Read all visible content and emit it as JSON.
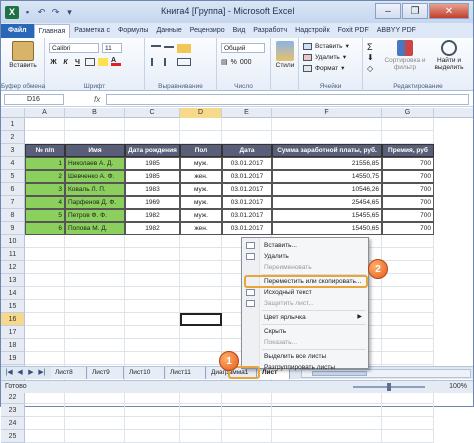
{
  "window": {
    "title": "Книга4 [Группа] - Microsoft Excel",
    "qat_icons": [
      "excel-logo-icon",
      "save-icon",
      "undo-icon",
      "redo-icon",
      "customize-icon"
    ],
    "logo_letter": "X",
    "min": "–",
    "max": "❐",
    "close": "✕"
  },
  "tabs": [
    "Файл",
    "Главная",
    "Разметка с",
    "Формулы",
    "Данные",
    "Рецензиро",
    "Вид",
    "Разработч",
    "Надстройк",
    "Foxit PDF",
    "ABBYY PDF"
  ],
  "ribbon": {
    "paste": "Вставить",
    "font_name": "Calibri",
    "font_size": "11",
    "bold": "Ж",
    "italic": "К",
    "underline": "Ч",
    "number_format": "Общий",
    "styles": "Стили",
    "insert": "Вставить",
    "delete": "Удалить",
    "format": "Формат",
    "sort": "Сортировка и фильтр",
    "find": "Найти и выделить",
    "groups": [
      "Буфер обмена",
      "Шрифт",
      "Выравнивание",
      "Число",
      "Ячейки",
      "Редактирование"
    ]
  },
  "formula_bar": {
    "name_box": "D16",
    "fx": "fx",
    "formula": ""
  },
  "columns": [
    "A",
    "B",
    "C",
    "D",
    "E",
    "F",
    "G"
  ],
  "selected_column": "D",
  "rows": [
    "1",
    "2",
    "3",
    "4",
    "5",
    "6",
    "7",
    "8",
    "9",
    "10",
    "11",
    "12",
    "13",
    "14",
    "15",
    "16",
    "17",
    "18",
    "19",
    "20",
    "21",
    "22",
    "23",
    "24",
    "25"
  ],
  "selected_row": "16",
  "table": {
    "headers": [
      "№ п/п",
      "Имя",
      "Дата рождения",
      "Пол",
      "Дата",
      "Сумма заработной платы, руб.",
      "Премия, руб"
    ],
    "data": [
      [
        "1",
        "Николаев А. Д.",
        "1985",
        "муж.",
        "03.01.2017",
        "21556,85",
        "700"
      ],
      [
        "2",
        "Шевченко А. Ф.",
        "1985",
        "жен.",
        "03.01.2017",
        "14550,75",
        "700"
      ],
      [
        "3",
        "Коваль Л. П.",
        "1983",
        "муж.",
        "03.01.2017",
        "10546,26",
        "700"
      ],
      [
        "4",
        "Парфенов Д. Ф.",
        "1969",
        "муж.",
        "03.01.2017",
        "25454,65",
        "700"
      ],
      [
        "5",
        "Петров Ф. Ф.",
        "1982",
        "муж.",
        "03.01.2017",
        "15455,65",
        "700"
      ],
      [
        "6",
        "Попова М. Д.",
        "1982",
        "жен.",
        "03.01.2017",
        "15450,65",
        "700"
      ]
    ]
  },
  "context_menu": {
    "items": [
      {
        "label": "Вставить...",
        "disabled": false,
        "icon": "insert-icon"
      },
      {
        "label": "Удалить",
        "disabled": false,
        "icon": "delete-icon"
      },
      {
        "label": "Переименовать",
        "disabled": true,
        "icon": ""
      },
      {
        "label": "Переместить или скопировать...",
        "disabled": false,
        "icon": ""
      },
      {
        "label": "Исходный текст",
        "disabled": false,
        "icon": "view-code-icon"
      },
      {
        "label": "Защитить лист...",
        "disabled": true,
        "icon": "protect-icon"
      },
      {
        "label": "Цвет ярлычка",
        "disabled": false,
        "icon": "",
        "submenu": "▶"
      },
      {
        "label": "Скрыть",
        "disabled": false,
        "icon": ""
      },
      {
        "label": "Показать...",
        "disabled": true,
        "icon": ""
      },
      {
        "label": "Выделить все листы",
        "disabled": false,
        "icon": ""
      },
      {
        "label": "Разгруппировать листы",
        "disabled": false,
        "icon": ""
      }
    ]
  },
  "sheet_tabs": [
    "Лист8",
    "Лист9",
    "Лист10",
    "Лист11",
    "Диаграмма1",
    "Лист"
  ],
  "active_sheet": "Лист",
  "status": {
    "ready": "Готово",
    "zoom": "100%"
  },
  "steps": [
    "1",
    "2"
  ],
  "colors": {
    "accent": "#2a67b8",
    "header": "#595f78",
    "green": "#8bd05c",
    "highlight": "#e8a53a"
  }
}
